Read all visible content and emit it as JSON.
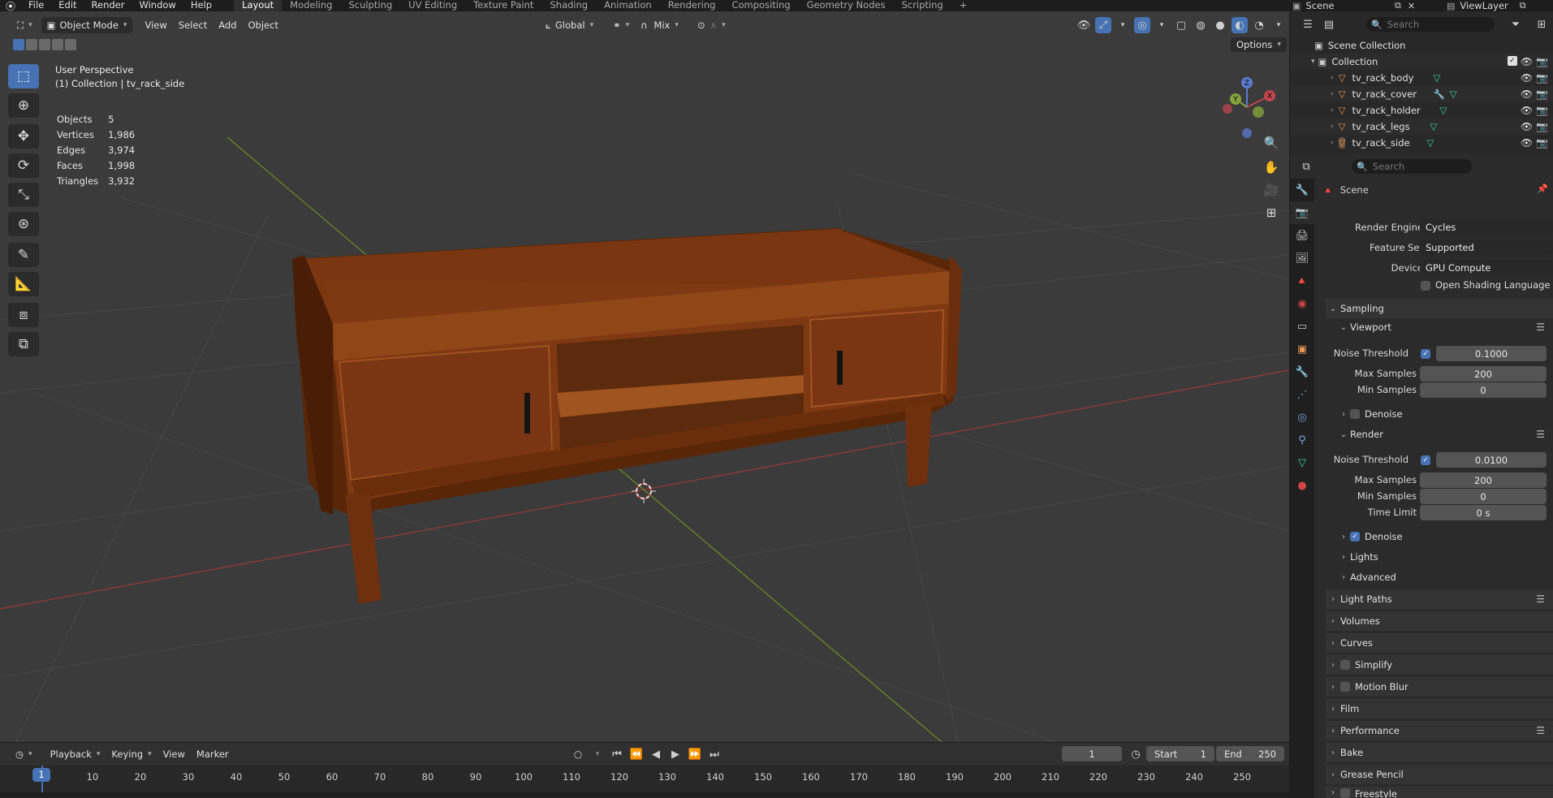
{
  "menubar": {
    "menus": [
      "File",
      "Edit",
      "Render",
      "Window",
      "Help"
    ],
    "workspaces": [
      "Layout",
      "Modeling",
      "Sculpting",
      "UV Editing",
      "Texture Paint",
      "Shading",
      "Animation",
      "Rendering",
      "Compositing",
      "Geometry Nodes",
      "Scripting"
    ],
    "active_workspace": "Layout",
    "add_tab": "+",
    "scene_name": "Scene",
    "view_layer": "ViewLayer"
  },
  "viewport": {
    "mode": "Object Mode",
    "menus": [
      "View",
      "Select",
      "Add",
      "Object"
    ],
    "transform_orientation": "Global",
    "snap_mode": "Mix",
    "options_label": "Options",
    "view_name": "User Perspective",
    "collection_info": "(1) Collection | tv_rack_side",
    "stats": [
      {
        "label": "Objects",
        "value": "5"
      },
      {
        "label": "Vertices",
        "value": "1,986"
      },
      {
        "label": "Edges",
        "value": "3,974"
      },
      {
        "label": "Faces",
        "value": "1,998"
      },
      {
        "label": "Triangles",
        "value": "3,932"
      }
    ],
    "gizmo_axes": {
      "z": "Z",
      "y": "Y",
      "x": "X"
    }
  },
  "timeline": {
    "menus": [
      "Playback",
      "Keying",
      "View",
      "Marker"
    ],
    "current_frame": "1",
    "start_label": "Start",
    "start": "1",
    "end_label": "End",
    "end": "250",
    "ruler": [
      "1",
      "10",
      "20",
      "30",
      "40",
      "50",
      "60",
      "70",
      "80",
      "90",
      "100",
      "110",
      "120",
      "130",
      "140",
      "150",
      "160",
      "170",
      "180",
      "190",
      "200",
      "210",
      "220",
      "230",
      "240",
      "250"
    ]
  },
  "outliner": {
    "search_placeholder": "Search",
    "scene_collection": "Scene Collection",
    "collection": "Collection",
    "objects": [
      "tv_rack_body",
      "tv_rack_cover",
      "tv_rack_holder",
      "tv_rack_legs",
      "tv_rack_side"
    ]
  },
  "properties": {
    "search_placeholder": "Search",
    "context": "Scene",
    "render_engine_label": "Render Engine",
    "render_engine": "Cycles",
    "feature_set_label": "Feature Set",
    "feature_set": "Supported",
    "device_label": "Device",
    "device": "GPU Compute",
    "osl_label": "Open Shading Language",
    "sampling": "Sampling",
    "viewport_sub": "Viewport",
    "render_sub": "Render",
    "noise_threshold_label": "Noise Threshold",
    "max_samples_label": "Max Samples",
    "min_samples_label": "Min Samples",
    "time_limit_label": "Time Limit",
    "viewport_noise": "0.1000",
    "viewport_max": "200",
    "viewport_min": "0",
    "render_noise": "0.0100",
    "render_max": "200",
    "render_min": "0",
    "render_time_limit": "0 s",
    "denoise": "Denoise",
    "lights": "Lights",
    "advanced": "Advanced",
    "panels": [
      "Light Paths",
      "Volumes",
      "Curves",
      "Simplify",
      "Motion Blur",
      "Film",
      "Performance",
      "Bake",
      "Grease Pencil",
      "Freestyle"
    ]
  }
}
